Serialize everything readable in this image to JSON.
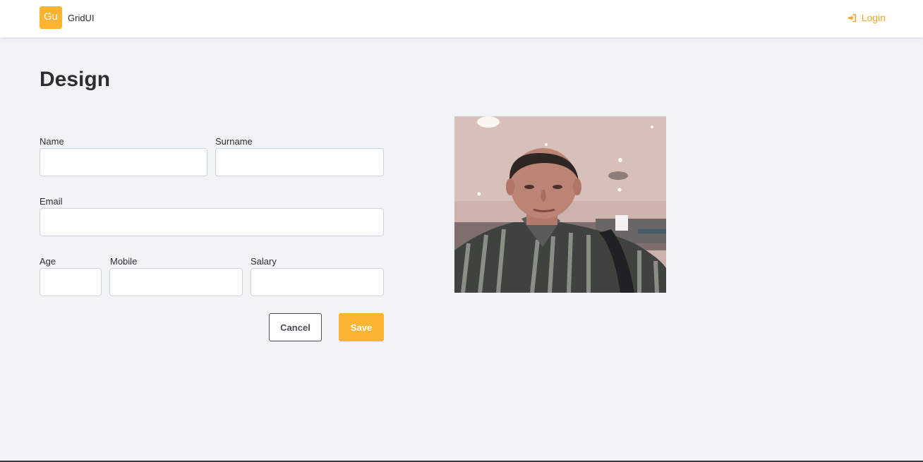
{
  "header": {
    "logo_text": "Gu",
    "brand_name": "GridUI",
    "login_label": "Login",
    "login_icon": "sign-in-icon",
    "accent_color": "#fbb431",
    "link_color": "#f5a623"
  },
  "page": {
    "title": "Design"
  },
  "form": {
    "name": {
      "label": "Name",
      "value": "",
      "placeholder": ""
    },
    "surname": {
      "label": "Surname",
      "value": "",
      "placeholder": ""
    },
    "email": {
      "label": "Email",
      "value": "",
      "placeholder": ""
    },
    "age": {
      "label": "Age",
      "value": "",
      "placeholder": ""
    },
    "mobile": {
      "label": "Mobile",
      "value": "",
      "placeholder": ""
    },
    "salary": {
      "label": "Salary",
      "value": "",
      "placeholder": ""
    },
    "cancel_label": "Cancel",
    "save_label": "Save"
  },
  "profile_photo": {
    "icon": "profile-photo"
  }
}
